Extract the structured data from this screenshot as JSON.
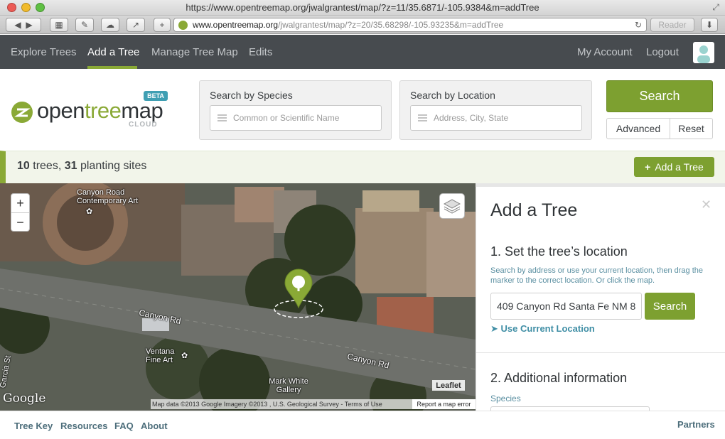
{
  "browser": {
    "title": "https://www.opentreemap.org/jwalgrantest/map/?z=11/35.6871/-105.9384&m=addTree",
    "url_host": "www.opentreemap.org",
    "url_path": "/jwalgrantest/map/?z=20/35.68298/-105.93235&m=addTree",
    "reader_label": "Reader"
  },
  "nav": {
    "items": [
      "Explore Trees",
      "Add a Tree",
      "Manage Tree Map",
      "Edits"
    ],
    "active": "Add a Tree",
    "right": [
      "My Account",
      "Logout"
    ]
  },
  "brand": {
    "name_prefix": "open",
    "name_tree": "tree",
    "name_suffix": "map",
    "badge": "BETA",
    "tagline": "CLOUD"
  },
  "search": {
    "species_label": "Search by Species",
    "species_placeholder": "Common or Scientific Name",
    "location_label": "Search by Location",
    "location_placeholder": "Address, City, State",
    "search_button": "Search",
    "advanced_button": "Advanced",
    "reset_button": "Reset"
  },
  "stats": {
    "trees_count": "10",
    "trees_word": "trees,",
    "sites_count": "31",
    "sites_word": "planting sites",
    "add_button": "Add a Tree"
  },
  "map": {
    "labels": {
      "canyon_road_art": "Canyon Road Contemporary Art",
      "canyon_rd_1": "Canyon Rd",
      "canyon_rd_2": "Canyon Rd",
      "ventana": "Ventana Fine Art",
      "mark_white": "Mark White Gallery",
      "garcia": "Garcia St"
    },
    "leaflet": "Leaflet",
    "attribution": "Map data ©2013 Google Imagery ©2013 , U.S. Geological Survey - Terms of Use",
    "report": "Report a map error",
    "google": "Google"
  },
  "panel": {
    "title": "Add a Tree",
    "step1_title": "1. Set the tree’s location",
    "help_text": "Search by address or use your current location, then drag the marker to the correct location. Or click the map.",
    "address_value": "409 Canyon Rd Santa Fe NM 8",
    "search_button": "Search",
    "use_location": "Use Current Location",
    "step2_title": "2. Additional information",
    "species_label": "Species"
  },
  "footer": {
    "links": [
      "Tree Key",
      "Resources",
      "FAQ",
      "About"
    ],
    "right": "Partners"
  },
  "colors": {
    "accent_green": "#7da030",
    "nav_bg": "#474b4f",
    "link_blue": "#3f8ea5"
  }
}
